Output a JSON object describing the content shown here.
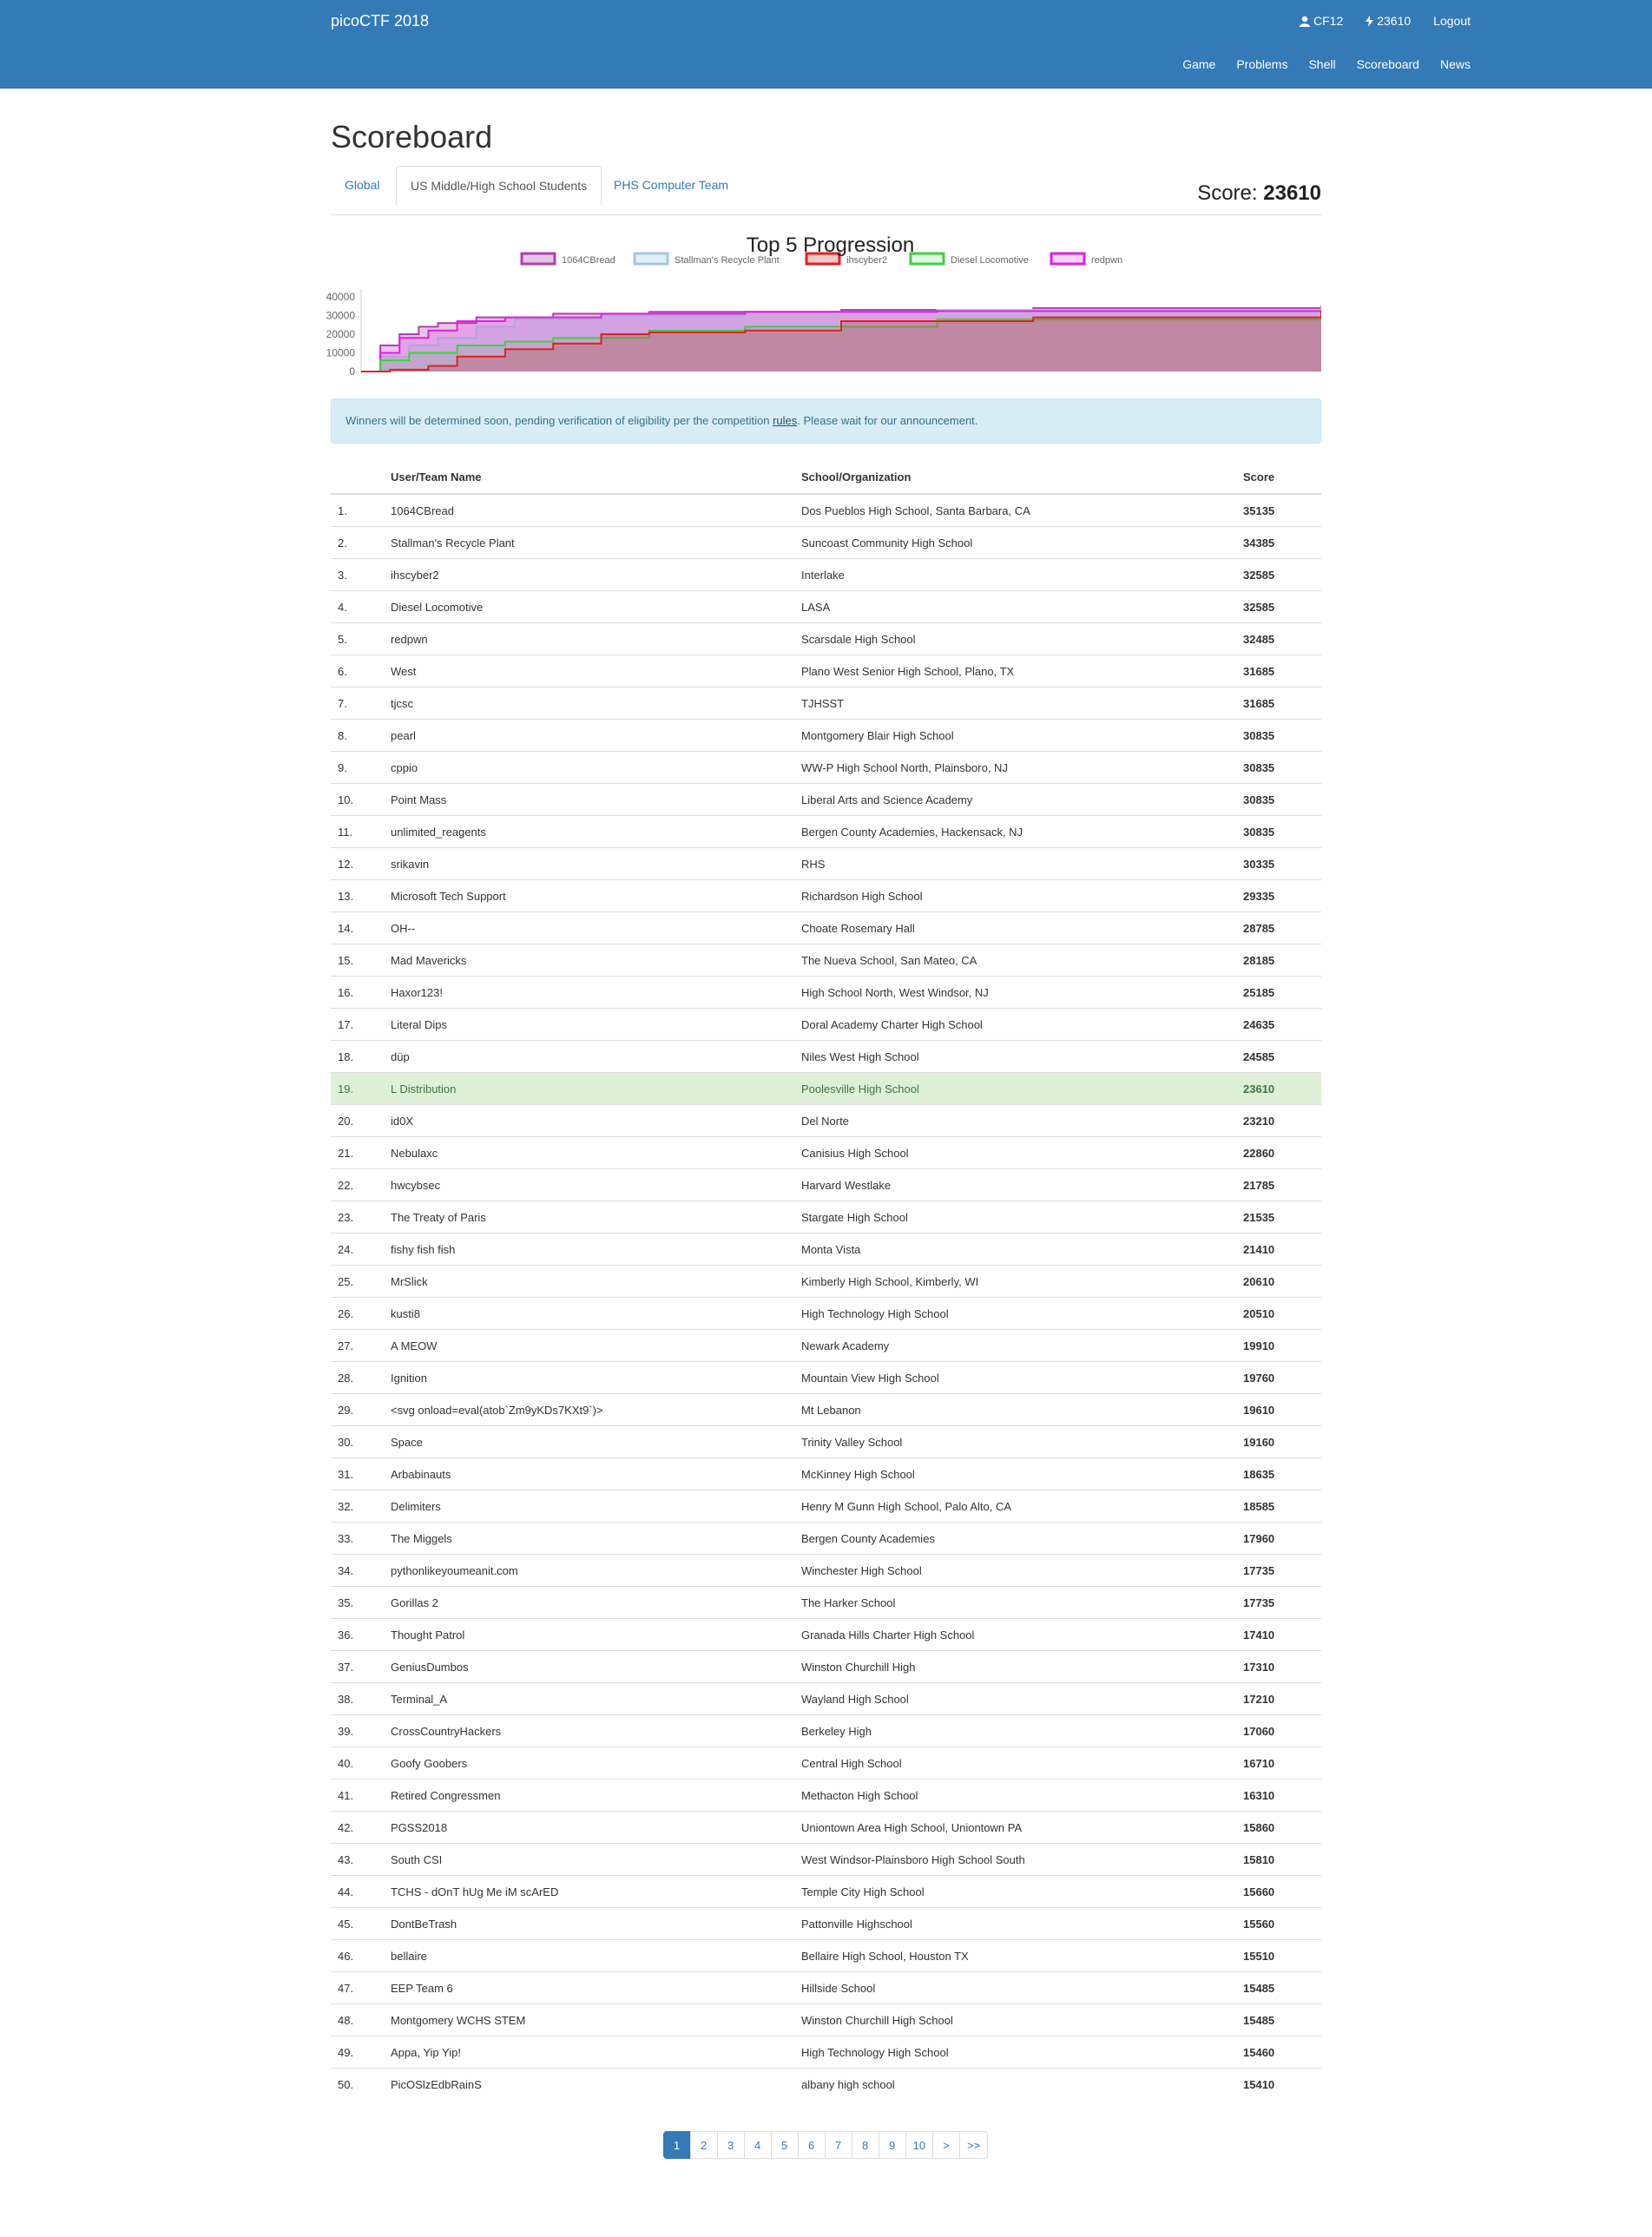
{
  "navbar": {
    "brand": "picoCTF 2018",
    "user": "CF12",
    "points": "23610",
    "logout": "Logout",
    "links": [
      "Game",
      "Problems",
      "Shell",
      "Scoreboard",
      "News"
    ]
  },
  "page": {
    "title": "Scoreboard",
    "tabs": [
      "Global",
      "US Middle/High School Students",
      "PHS Computer Team"
    ],
    "active_tab": "US Middle/High School Students",
    "score_label": "Score:",
    "score_value": "23610"
  },
  "chart_data": {
    "type": "area",
    "title": "Top 5 Progression",
    "y_ticks": [
      "40000",
      "30000",
      "20000",
      "10000",
      "0"
    ],
    "ylim": [
      0,
      40000
    ],
    "series": [
      {
        "name": "1064CBread",
        "color": "#b040b0",
        "fill": "rgba(176,64,176,0.3)",
        "x": [
          0,
          0.02,
          0.04,
          0.06,
          0.08,
          0.12,
          0.2,
          0.3,
          0.5,
          0.7,
          1.0
        ],
        "values": [
          0,
          14000,
          20000,
          24000,
          26000,
          29000,
          31000,
          32000,
          33000,
          34000,
          35135
        ]
      },
      {
        "name": "Stallman's Recycle Plant",
        "color": "#a0c8e0",
        "fill": "rgba(160,200,224,0.3)",
        "x": [
          0,
          0.02,
          0.05,
          0.08,
          0.12,
          0.16,
          0.25,
          0.4,
          0.6,
          1.0
        ],
        "values": [
          0,
          8000,
          14000,
          18000,
          24000,
          28000,
          30000,
          32000,
          33000,
          34385
        ]
      },
      {
        "name": "ihscyber2",
        "color": "#e02020",
        "fill": "rgba(200,40,40,0.25)",
        "x": [
          0,
          0.03,
          0.07,
          0.1,
          0.15,
          0.2,
          0.25,
          0.3,
          0.4,
          0.5,
          0.7,
          1.0
        ],
        "values": [
          0,
          1000,
          3000,
          8000,
          12000,
          15000,
          20000,
          21000,
          22000,
          27000,
          29000,
          32585
        ]
      },
      {
        "name": "Diesel Locomotive",
        "color": "#40d040",
        "fill": "rgba(64,208,64,0.15)",
        "x": [
          0,
          0.02,
          0.05,
          0.1,
          0.15,
          0.2,
          0.3,
          0.4,
          0.6,
          1.0
        ],
        "values": [
          0,
          6000,
          10000,
          14000,
          16000,
          18000,
          22000,
          24000,
          28000,
          32585
        ]
      },
      {
        "name": "redpwn",
        "color": "#e020e0",
        "fill": "rgba(224,32,224,0.2)",
        "x": [
          0,
          0.02,
          0.04,
          0.07,
          0.1,
          0.15,
          0.25,
          0.4,
          0.6,
          1.0
        ],
        "values": [
          0,
          10000,
          18000,
          22000,
          27000,
          29000,
          31000,
          32000,
          32400,
          32485
        ]
      }
    ]
  },
  "alert": {
    "text_before": "Winners will be determined soon, pending verification of eligibility per the competition ",
    "link": "rules",
    "text_after": ". Please wait for our announcement."
  },
  "table": {
    "headers": [
      "",
      "User/Team Name",
      "School/Organization",
      "Score"
    ],
    "rows": [
      [
        "1.",
        "1064CBread",
        "Dos Pueblos High School, Santa Barbara, CA",
        "35135"
      ],
      [
        "2.",
        "Stallman's Recycle Plant",
        "Suncoast Community High School",
        "34385"
      ],
      [
        "3.",
        "ihscyber2",
        "Interlake",
        "32585"
      ],
      [
        "4.",
        "Diesel Locomotive",
        "LASA",
        "32585"
      ],
      [
        "5.",
        "redpwn",
        "Scarsdale High School",
        "32485"
      ],
      [
        "6.",
        "West",
        "Plano West Senior High School, Plano, TX",
        "31685"
      ],
      [
        "7.",
        "tjcsc",
        "TJHSST",
        "31685"
      ],
      [
        "8.",
        "pearl",
        "Montgomery Blair High School",
        "30835"
      ],
      [
        "9.",
        "cppio",
        "WW-P High School North, Plainsboro, NJ",
        "30835"
      ],
      [
        "10.",
        "Point Mass",
        "Liberal Arts and Science Academy",
        "30835"
      ],
      [
        "11.",
        "unlimited_reagents",
        "Bergen County Academies, Hackensack, NJ",
        "30835"
      ],
      [
        "12.",
        "srikavin",
        "RHS",
        "30335"
      ],
      [
        "13.",
        "Microsoft Tech Support",
        "Richardson High School",
        "29335"
      ],
      [
        "14.",
        "OH--",
        "Choate Rosemary Hall",
        "28785"
      ],
      [
        "15.",
        "Mad Mavericks",
        "The Nueva School, San Mateo, CA",
        "28185"
      ],
      [
        "16.",
        "Haxor123!",
        "High School North, West Windsor, NJ",
        "25185"
      ],
      [
        "17.",
        "Literal Dips",
        "Doral Academy Charter High School",
        "24635"
      ],
      [
        "18.",
        "düp",
        "Niles West High School",
        "24585"
      ],
      [
        "19.",
        "L Distribution",
        "Poolesville High School",
        "23610"
      ],
      [
        "20.",
        "id0X",
        "Del Norte",
        "23210"
      ],
      [
        "21.",
        "Nebulaxc",
        "Canisius High School",
        "22860"
      ],
      [
        "22.",
        "hwcybsec",
        "Harvard Westlake",
        "21785"
      ],
      [
        "23.",
        "The Treaty of Paris",
        "Stargate High School",
        "21535"
      ],
      [
        "24.",
        "fishy fish fish",
        "Monta Vista",
        "21410"
      ],
      [
        "25.",
        "MrSlick",
        "Kimberly High School, Kimberly, WI",
        "20610"
      ],
      [
        "26.",
        "kusti8",
        "High Technology High School",
        "20510"
      ],
      [
        "27.",
        "A MEOW",
        "Newark Academy",
        "19910"
      ],
      [
        "28.",
        "Ignition",
        "Mountain View High School",
        "19760"
      ],
      [
        "29.",
        "<svg onload=eval(atob`Zm9yKDs7KXt9`)>",
        "Mt Lebanon",
        "19610"
      ],
      [
        "30.",
        "Space",
        "Trinity Valley School",
        "19160"
      ],
      [
        "31.",
        "Arbabinauts",
        "McKinney High School",
        "18635"
      ],
      [
        "32.",
        "Delimiters",
        "Henry M Gunn High School, Palo Alto, CA",
        "18585"
      ],
      [
        "33.",
        "The Miggels",
        "Bergen County Academies",
        "17960"
      ],
      [
        "34.",
        "pythonlikeyoumeanit.com",
        "Winchester High School",
        "17735"
      ],
      [
        "35.",
        "Gorillas 2",
        "The Harker School",
        "17735"
      ],
      [
        "36.",
        "Thought Patrol",
        "Granada Hills Charter High School",
        "17410"
      ],
      [
        "37.",
        "GeniusDumbos",
        "Winston Churchill High",
        "17310"
      ],
      [
        "38.",
        "Terminal_A",
        "Wayland High School",
        "17210"
      ],
      [
        "39.",
        "CrossCountryHackers",
        "Berkeley High",
        "17060"
      ],
      [
        "40.",
        "Goofy Goobers",
        "Central High School",
        "16710"
      ],
      [
        "41.",
        "Retired Congressmen",
        "Methacton High School",
        "16310"
      ],
      [
        "42.",
        "PGSS2018",
        "Uniontown Area High School, Uniontown PA",
        "15860"
      ],
      [
        "43.",
        "South CSI",
        "West Windsor-Plainsboro High School South",
        "15810"
      ],
      [
        "44.",
        "TCHS - dOnT hUg Me iM scArED",
        "Temple City High School",
        "15660"
      ],
      [
        "45.",
        "DontBeTrash",
        "Pattonville Highschool",
        "15560"
      ],
      [
        "46.",
        "bellaire",
        "Bellaire High School, Houston TX",
        "15510"
      ],
      [
        "47.",
        "EEP Team 6",
        "Hillside School",
        "15485"
      ],
      [
        "48.",
        "Montgomery WCHS STEM",
        "Winston Churchill High School",
        "15485"
      ],
      [
        "49.",
        "Appa, Yip Yip!",
        "High Technology High School",
        "15460"
      ],
      [
        "50.",
        "PicOSlzEdbRainS",
        "albany high school",
        "15410"
      ]
    ],
    "highlight_index": 18
  },
  "pagination": [
    "1",
    "2",
    "3",
    "4",
    "5",
    "6",
    "7",
    "8",
    "9",
    "10",
    ">",
    ">>"
  ],
  "pagination_active": "1",
  "icons": {
    "user": "user-icon",
    "points": "bolt-icon"
  }
}
